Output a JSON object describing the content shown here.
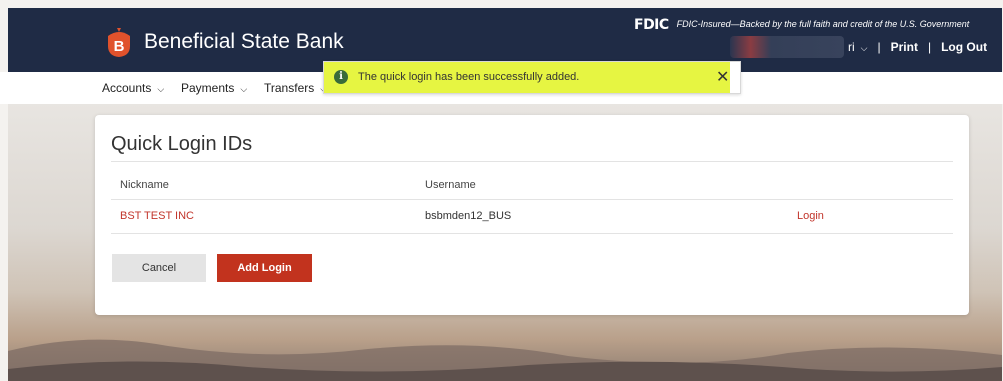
{
  "header": {
    "brand_name": "Beneficial State Bank",
    "brand_initial": "B",
    "fdic_logo": "FDIC",
    "fdic_text": "FDIC-Insured—Backed by the full faith and credit of the U.S. Government",
    "user_fragment": "ri",
    "print_label": "Print",
    "logout_label": "Log Out",
    "separator": "|",
    "colors": {
      "bar": "#1f2b45",
      "logo": "#e0522c"
    }
  },
  "nav": {
    "items": [
      {
        "label": "Accounts",
        "icon": "chevron-down-icon"
      },
      {
        "label": "Payments",
        "icon": "chevron-down-icon"
      },
      {
        "label": "Transfers",
        "icon": "chevron-down-icon"
      }
    ]
  },
  "toast": {
    "message": "The quick login has been successfully added.",
    "info_glyph": "i",
    "close_glyph": "✕",
    "highlight_color": "#e6f542"
  },
  "card": {
    "title": "Quick Login IDs",
    "columns": {
      "nickname": "Nickname",
      "username": "Username"
    },
    "rows": [
      {
        "nickname": "BST TEST INC",
        "username": "bsbmden12_BUS",
        "action": "Login"
      }
    ],
    "cancel_label": "Cancel",
    "add_label": "Add Login",
    "accent": "#c2331e"
  }
}
